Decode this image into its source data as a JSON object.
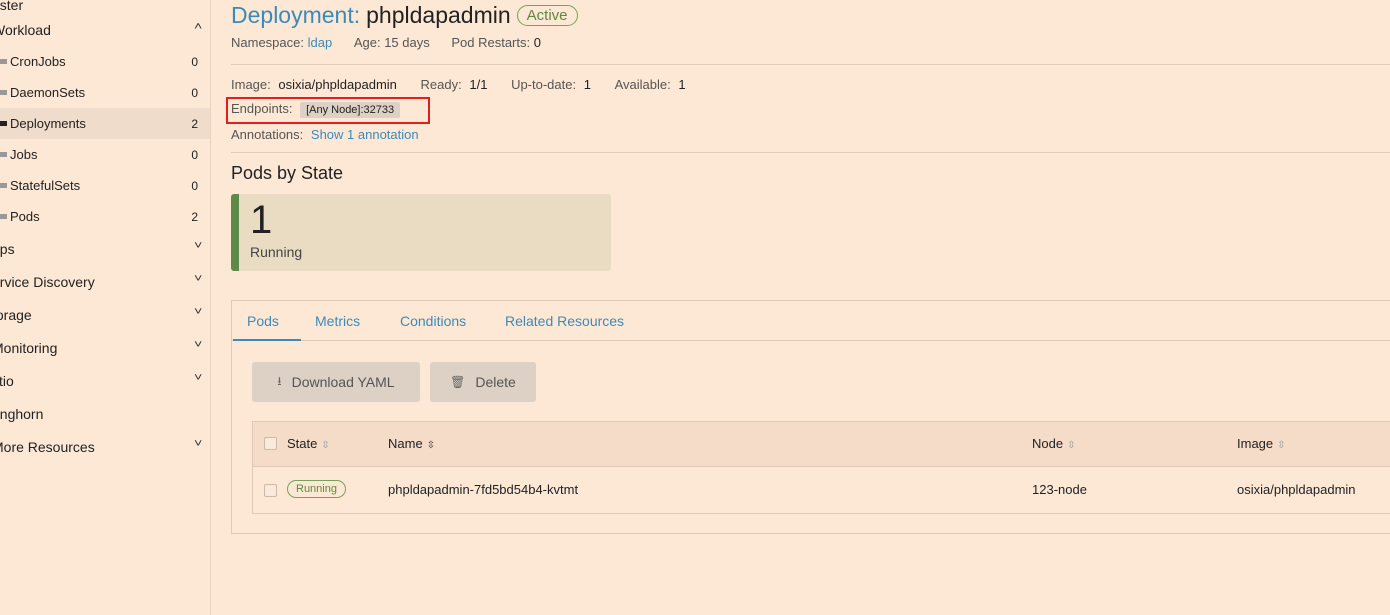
{
  "sidebar": {
    "top_partial": "uster",
    "workload": {
      "label": "Workload"
    },
    "items": [
      {
        "label": "CronJobs",
        "count": "0"
      },
      {
        "label": "DaemonSets",
        "count": "0"
      },
      {
        "label": "Deployments",
        "count": "2"
      },
      {
        "label": "Jobs",
        "count": "0"
      },
      {
        "label": "StatefulSets",
        "count": "0"
      },
      {
        "label": "Pods",
        "count": "2"
      }
    ],
    "groups": [
      {
        "label": "pps"
      },
      {
        "label": "ervice Discovery"
      },
      {
        "label": "torage"
      },
      {
        "label": "Monitoring"
      },
      {
        "label": "stio"
      },
      {
        "label": "onghorn"
      },
      {
        "label": "More Resources"
      }
    ]
  },
  "header": {
    "kind": "Deployment:",
    "name": "phpldapadmin",
    "status": "Active"
  },
  "meta": {
    "namespace_label": "Namespace:",
    "namespace": "ldap",
    "age_label": "Age:",
    "age": "15 days",
    "restarts_label": "Pod Restarts:",
    "restarts": "0"
  },
  "details": {
    "image_label": "Image:",
    "image": "osixia/phpldapadmin",
    "ready_label": "Ready:",
    "ready": "1/1",
    "uptodate_label": "Up-to-date:",
    "uptodate": "1",
    "available_label": "Available:",
    "available": "1",
    "endpoints_label": "Endpoints:",
    "endpoint": "[Any Node]:32733",
    "annotations_label": "Annotations:",
    "annotations_link": "Show 1 annotation"
  },
  "pods_by_state": {
    "title": "Pods by State",
    "count": "1",
    "state": "Running"
  },
  "tabs": [
    {
      "label": "Pods"
    },
    {
      "label": "Metrics"
    },
    {
      "label": "Conditions"
    },
    {
      "label": "Related Resources"
    }
  ],
  "actions": {
    "download": "Download YAML",
    "delete": "Delete"
  },
  "table": {
    "headers": {
      "state": "State",
      "name": "Name",
      "node": "Node",
      "image": "Image"
    },
    "rows": [
      {
        "state": "Running",
        "name": "phpldapadmin-7fd5bd54b4-kvtmt",
        "node": "123-node",
        "image": "osixia/phpldapadmin"
      }
    ]
  },
  "colors": {
    "background": "#fde8d6",
    "accent": "#3d8ab8",
    "running": "#5d8a47",
    "highlight": "#e02020"
  }
}
